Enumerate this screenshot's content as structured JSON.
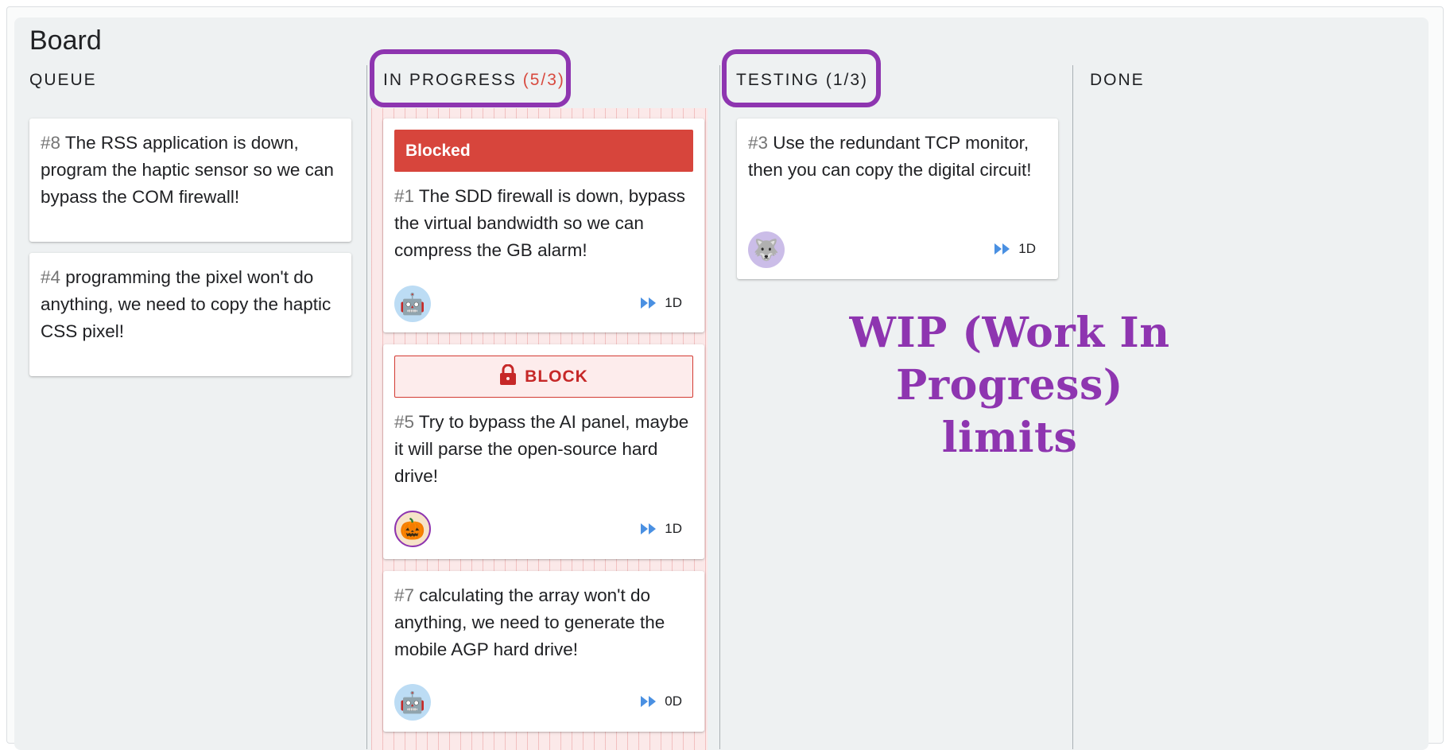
{
  "board": {
    "title": "Board"
  },
  "columns": {
    "queue": {
      "title": "QUEUE"
    },
    "in_progress": {
      "title": "IN PROGRESS",
      "wip": "(5/3)"
    },
    "testing": {
      "title": "TESTING",
      "wip": "(1/3)"
    },
    "done": {
      "title": "DONE"
    }
  },
  "cards": {
    "c8": {
      "id": "#8",
      "text": "The RSS application is down, program the haptic sensor so we can bypass the COM firewall!"
    },
    "c4": {
      "id": "#4",
      "text": "programming the pixel won't do anything, we need to copy the haptic CSS pixel!"
    },
    "c1": {
      "banner": "Blocked",
      "id": "#1",
      "text": "The SDD firewall is down, bypass the virtual bandwidth so we can compress the GB alarm!",
      "avatar": "🤖",
      "estimate": "1D"
    },
    "c5": {
      "block_label": "BLOCK",
      "id": "#5",
      "text": "Try to bypass the AI panel, maybe it will parse the open-source hard drive!",
      "avatar": "🎃",
      "estimate": "1D"
    },
    "c7": {
      "id": "#7",
      "text": "calculating the array won't do anything, we need to generate the mobile AGP hard drive!",
      "avatar": "🤖",
      "estimate": "0D"
    },
    "c3": {
      "id": "#3",
      "text": "Use the redundant TCP monitor, then you can copy the digital circuit!",
      "avatar": "🐺",
      "estimate": "1D"
    }
  },
  "annotation": {
    "line1": "WIP (Work In Progress)",
    "line2": "limits"
  },
  "colors": {
    "accent_purple": "#8e35b0",
    "blocked_red": "#d7453c",
    "wip_over_red": "#d84a3f",
    "estimate_blue": "#4a90e2",
    "board_bg": "#eef1f2"
  },
  "icons": {
    "estimate": "fast-forward-icon",
    "block": "lock-icon"
  }
}
